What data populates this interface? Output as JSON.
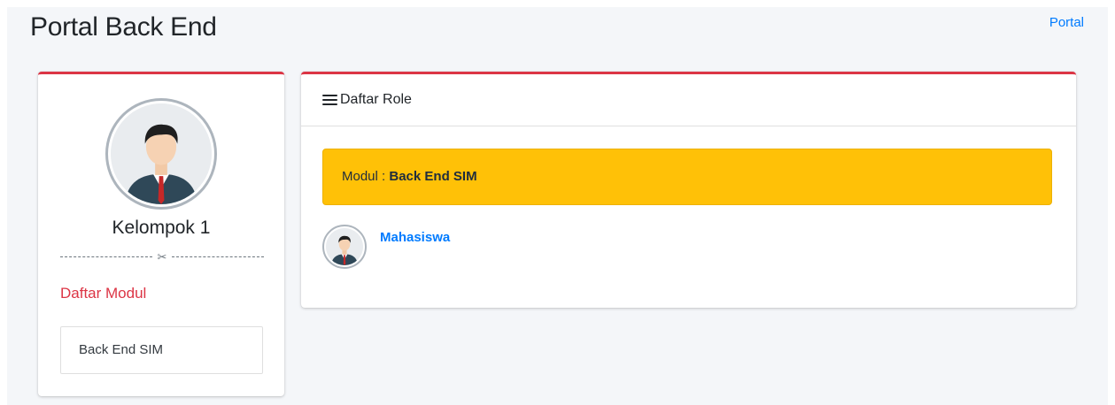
{
  "header": {
    "title": "Portal Back End",
    "portal_link": "Portal"
  },
  "profile": {
    "name": "Kelompok 1",
    "avatar_icon": "user-avatar-icon",
    "divider_icon": "scissors-icon",
    "modules_heading": "Daftar Modul",
    "modules": [
      {
        "label": "Back End SIM"
      }
    ]
  },
  "roles_panel": {
    "header_icon": "bars-icon",
    "title": "Daftar Role",
    "module_label": "Modul :",
    "module_name": "Back End SIM",
    "roles": [
      {
        "name": "Mahasiswa",
        "avatar_icon": "user-avatar-icon"
      }
    ]
  },
  "colors": {
    "accent_red": "#dc3545",
    "link_blue": "#007bff",
    "alert_yellow": "#ffc107",
    "page_bg": "#f4f6f9"
  }
}
